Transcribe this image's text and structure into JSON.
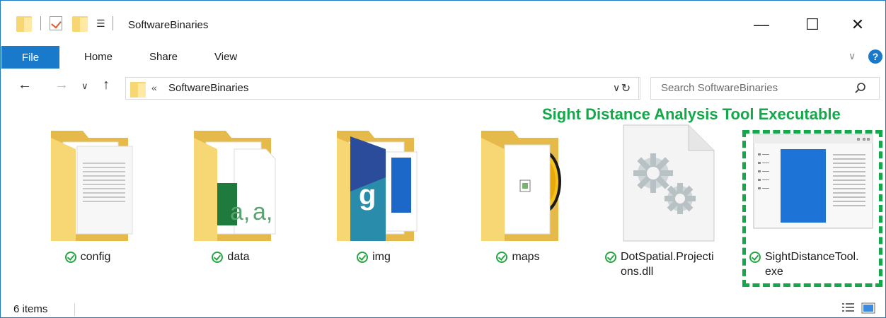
{
  "window": {
    "title": "SoftwareBinaries",
    "qa_dropdown": "☰",
    "minimize_glyph": "—",
    "maximize_glyph": "☐",
    "close_glyph": "✕"
  },
  "ribbon": {
    "tabs": [
      "File",
      "Home",
      "Share",
      "View"
    ],
    "expand_glyph": "∨",
    "help_glyph": "?"
  },
  "nav": {
    "back_glyph": "←",
    "forward_glyph": "→",
    "recent_glyph": "∨",
    "up_glyph": "↑",
    "address_separator": "«",
    "address_path": "SoftwareBinaries",
    "address_dropdown_glyph": "∨",
    "refresh_glyph": "↻",
    "search_placeholder": "Search SoftwareBinaries"
  },
  "annotation": {
    "text": "Sight Distance Analysis Tool Executable",
    "color": "#14a84a"
  },
  "items": [
    {
      "name": "config",
      "icon": "folder-documents-icon"
    },
    {
      "name": "data",
      "icon": "folder-spreadsheets-icon"
    },
    {
      "name": "img",
      "icon": "folder-images-icon"
    },
    {
      "name": "maps",
      "icon": "folder-maps-icon"
    },
    {
      "name_line1": "DotSpatial.Projecti",
      "name_line2": "ons.dll",
      "icon": "dll-gears-icon"
    },
    {
      "name_line1": "SightDistanceTool.",
      "name_line2": "exe",
      "icon": "exe-window-icon"
    }
  ],
  "status": {
    "item_count": "6 items"
  },
  "colors": {
    "accent": "#1979ca",
    "folder": "#f7d774",
    "sync_ok": "#26a544"
  }
}
